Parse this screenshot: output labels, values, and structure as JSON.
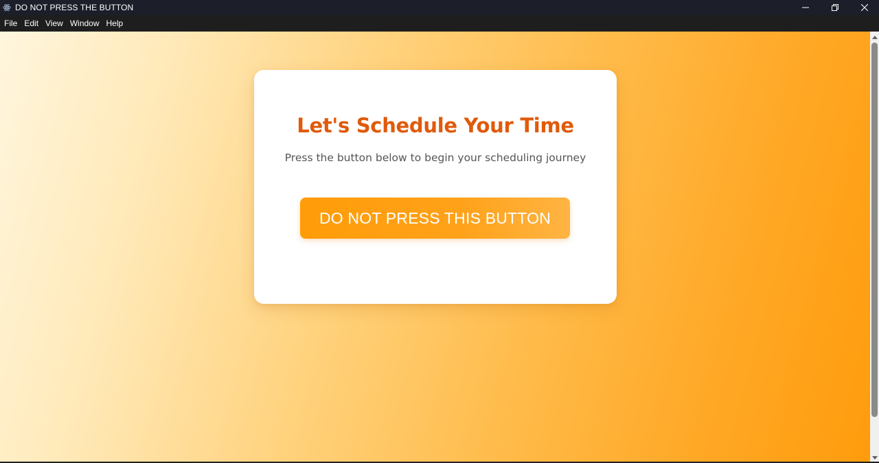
{
  "window": {
    "title": "DO NOT PRESS THE BUTTON",
    "app_icon": "electron-atom-icon",
    "controls": [
      "minimize-icon",
      "restore-icon",
      "close-icon"
    ]
  },
  "menubar": {
    "items": [
      "File",
      "Edit",
      "View",
      "Window",
      "Help"
    ]
  },
  "card": {
    "title": "Let's Schedule Your Time",
    "subtitle": "Press the button below to begin your scheduling journey",
    "button_label": "DO NOT PRESS THIS BUTTON"
  },
  "colors": {
    "accent_orange": "#ff9c08",
    "title_orange": "#e05a0b",
    "subtitle_gray": "#555555",
    "titlebar_bg": "#1c1f2a",
    "menubar_bg": "#1e1e1e"
  },
  "scrollbar": {
    "icons": [
      "scroll-up-arrow-icon",
      "scroll-down-arrow-icon"
    ]
  }
}
